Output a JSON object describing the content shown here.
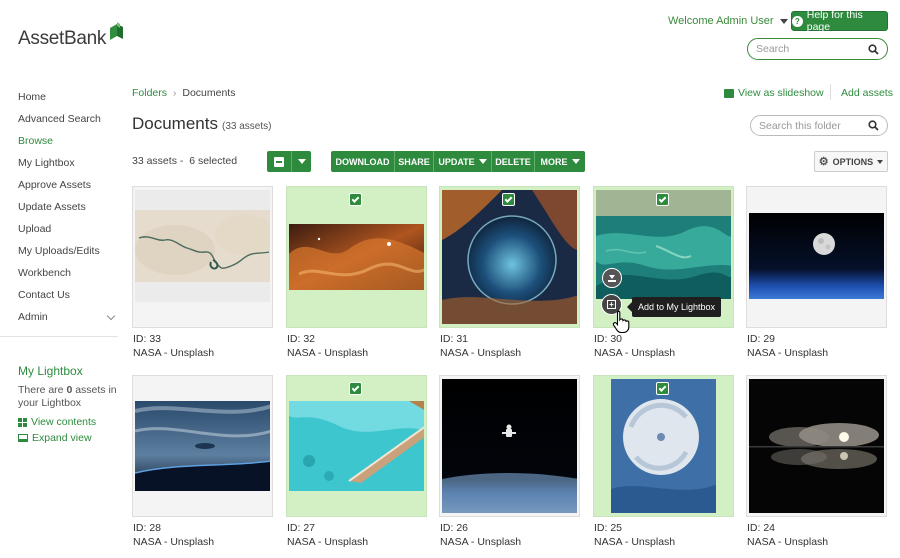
{
  "brand": {
    "name": "AssetBank"
  },
  "header": {
    "welcome": "Welcome Admin User",
    "help_label": "Help for this page",
    "search_placeholder": "Search"
  },
  "sidebar": {
    "items": [
      {
        "label": "Home"
      },
      {
        "label": "Advanced Search"
      },
      {
        "label": "Browse",
        "active": true
      },
      {
        "label": "My Lightbox"
      },
      {
        "label": "Approve Assets"
      },
      {
        "label": "Update Assets"
      },
      {
        "label": "Upload"
      },
      {
        "label": "My Uploads/Edits"
      },
      {
        "label": "Workbench"
      },
      {
        "label": "Contact Us"
      },
      {
        "label": "Admin"
      }
    ],
    "lightbox": {
      "title": "My Lightbox",
      "text_pre": "There are ",
      "count": "0",
      "text_post": " assets in your Lightbox",
      "view_contents": "View contents",
      "expand_view": "Expand view"
    }
  },
  "breadcrumb": {
    "root": "Folders",
    "separator": "›",
    "current": "Documents"
  },
  "top_links": {
    "slideshow": "View as slideshow",
    "add_assets": "Add assets"
  },
  "page": {
    "title": "Documents",
    "count": "(33 assets)",
    "folder_search_placeholder": "Search this folder"
  },
  "toolbar": {
    "asset_count": "33 assets",
    "selected": "6 selected",
    "actions": [
      "DOWNLOAD",
      "SHARE",
      "UPDATE",
      "DELETE",
      "MORE"
    ],
    "options": "OPTIONS"
  },
  "assets": [
    {
      "id": "ID: 33",
      "source": "NASA - Unsplash",
      "selected": false
    },
    {
      "id": "ID: 32",
      "source": "NASA - Unsplash",
      "selected": true
    },
    {
      "id": "ID: 31",
      "source": "NASA - Unsplash",
      "selected": true
    },
    {
      "id": "ID: 30",
      "source": "NASA - Unsplash",
      "selected": true
    },
    {
      "id": "ID: 29",
      "source": "NASA - Unsplash",
      "selected": false
    },
    {
      "id": "ID: 28",
      "source": "NASA - Unsplash",
      "selected": false
    },
    {
      "id": "ID: 27",
      "source": "NASA - Unsplash",
      "selected": true
    },
    {
      "id": "ID: 26",
      "source": "NASA - Unsplash",
      "selected": false
    },
    {
      "id": "ID: 25",
      "source": "NASA - Unsplash",
      "selected": true
    },
    {
      "id": "ID: 24",
      "source": "NASA - Unsplash",
      "selected": false
    }
  ],
  "tooltip": "Add to My Lightbox",
  "colors": {
    "brand_green": "#2e8b3e",
    "selected_bg": "#d2f0c4"
  }
}
